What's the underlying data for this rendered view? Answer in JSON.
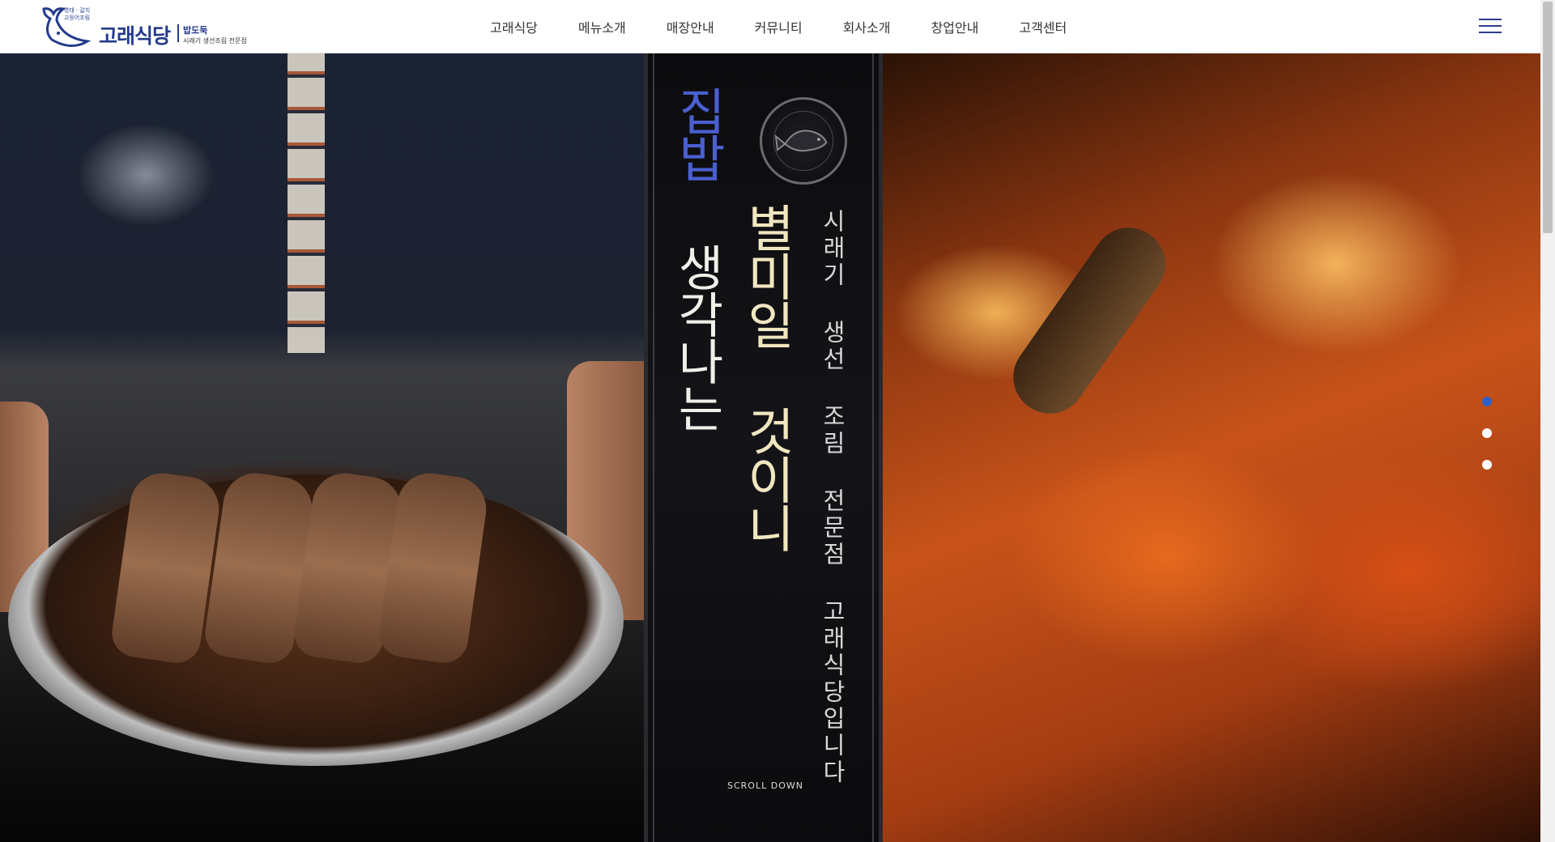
{
  "logo": {
    "tag": "명태 · 갈치\n고등어조림",
    "brand": "고래식당",
    "sub_title": "밥도둑",
    "sub_text": "시래기 생선조림 전문점"
  },
  "nav": {
    "items": [
      "고래식당",
      "메뉴소개",
      "매장안내",
      "커뮤니티",
      "회사소개",
      "창업안내",
      "고객센터"
    ]
  },
  "hero": {
    "headline_blue": "집밥",
    "headline_white": "생각나는",
    "headline_gold": "별미일 것이니",
    "tagline": "시래기 생선 조림 전문점 고래식당입니다",
    "scroll_label": "SCROLL DOWN"
  },
  "slider": {
    "slide_count": 3,
    "active_index": 0
  },
  "colors": {
    "brand_blue": "#243a8c",
    "accent_blue": "#2e61c8",
    "gold": "#e7c977"
  },
  "icons": {
    "menu": "hamburger-icon",
    "seal": "fish-seal-icon"
  }
}
